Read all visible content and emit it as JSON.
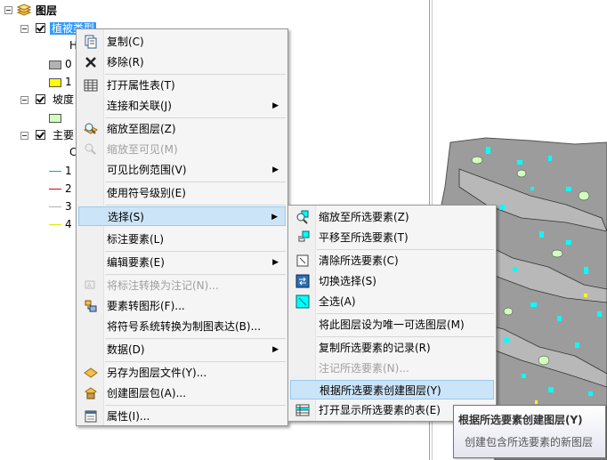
{
  "toc": {
    "root_label": "图层",
    "layer1": {
      "name": "植被类型",
      "sub_heading": "H",
      "classes": [
        "0",
        "1"
      ]
    },
    "layer2": {
      "name": "坡度"
    },
    "layer3": {
      "name": "主要",
      "sub_heading": "C",
      "classes": [
        "1",
        "2",
        "3",
        "4"
      ]
    }
  },
  "colors": {
    "swatch_gray": "#b2b2b2",
    "swatch_yellow": "#ffff00",
    "swatch_green": "#d3ffbe",
    "line1": "#00a9e6",
    "line2": "#e60000",
    "line3": "#b0b0b0",
    "line4": "#e6e600",
    "menu_highlight": "#cce4f7",
    "map_cyan": "#00ffff",
    "map_gray": "#9c9c9c"
  },
  "context_menu": {
    "items": [
      {
        "label": "复制(C)",
        "icon": "copy-icon"
      },
      {
        "label": "移除(R)",
        "icon": "remove-icon"
      },
      {
        "label": "打开属性表(T)",
        "icon": "table-icon"
      },
      {
        "label": "连接和关联(J)",
        "submenu": true
      },
      {
        "label": "缩放至图层(Z)",
        "icon": "zoom-layer-icon"
      },
      {
        "label": "缩放至可见(M)",
        "disabled": true
      },
      {
        "label": "可见比例范围(V)",
        "submenu": true
      },
      {
        "label": "使用符号级别(E)"
      },
      {
        "label": "选择(S)",
        "submenu": true
      },
      {
        "label": "标注要素(L)"
      },
      {
        "label": "编辑要素(E)",
        "submenu": true
      },
      {
        "label": "将标注转换为注记(N)...",
        "disabled": true
      },
      {
        "label": "要素转图形(F)...",
        "icon": "feature-to-graphic-icon"
      },
      {
        "label": "将符号系统转换为制图表达(B)..."
      },
      {
        "label": "数据(D)",
        "submenu": true
      },
      {
        "label": "另存为图层文件(Y)...",
        "icon": "layer-file-icon"
      },
      {
        "label": "创建图层包(A)...",
        "icon": "layer-package-icon"
      },
      {
        "label": "属性(I)...",
        "icon": "properties-icon"
      }
    ]
  },
  "submenu": {
    "items": [
      {
        "label": "缩放至所选要素(Z)",
        "icon": "zoom-selected-icon"
      },
      {
        "label": "平移至所选要素(T)",
        "icon": "pan-selected-icon"
      },
      {
        "label": "清除所选要素(C)",
        "icon": "clear-selection-icon"
      },
      {
        "label": "切换选择(S)",
        "icon": "switch-selection-icon"
      },
      {
        "label": "全选(A)",
        "icon": "select-all-icon"
      },
      {
        "label": "将此图层设为唯一可选图层(M)"
      },
      {
        "label": "复制所选要素的记录(R)"
      },
      {
        "label": "注记所选要素(N)...",
        "disabled": true
      },
      {
        "label": "根据所选要素创建图层(Y)"
      },
      {
        "label": "打开显示所选要素的表(E)",
        "icon": "table-selected-icon"
      }
    ]
  },
  "tooltip": {
    "title": "根据所选要素创建图层(Y)",
    "description": "创建包含所选要素的新图层"
  }
}
